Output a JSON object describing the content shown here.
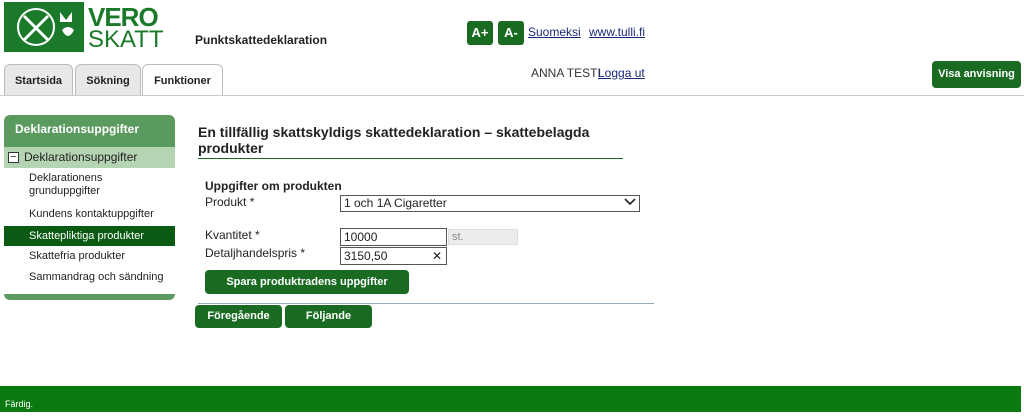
{
  "brand": {
    "line1": "VERO",
    "line2": "SKATT"
  },
  "header": {
    "app_title": "Punktskattedeklaration",
    "font_increase": "A+",
    "font_decrease": "A-",
    "link_language": "Suomeksi",
    "link_customs": "www.tulli.fi"
  },
  "tabs": [
    {
      "label": "Startsida"
    },
    {
      "label": "Sökning"
    },
    {
      "label": "Funktioner"
    }
  ],
  "user": {
    "name": "ANNA TESTI",
    "logout": "Logga ut"
  },
  "help_button": "Visa anvisning",
  "sidebar": {
    "title": "Deklarationsuppgifter",
    "group": "Deklarationsuppgifter",
    "items": [
      {
        "label": "Deklarationens grunduppgifter"
      },
      {
        "label": "Kundens kontaktuppgifter"
      },
      {
        "label": "Skattepliktiga produkter",
        "active": true
      },
      {
        "label": "Skattefria produkter"
      },
      {
        "label": "Sammandrag och sändning"
      }
    ]
  },
  "main": {
    "title": "En tillfällig skattskyldigs skattedeklaration – skattebelagda produkter",
    "section_title": "Uppgifter om produkten",
    "produkt_label": "Produkt *",
    "produkt_value": "1 och 1A Cigaretter",
    "kvantitet_label": "Kvantitet *",
    "kvantitet_value": "10000",
    "unit": "st.",
    "pris_label": "Detaljhandelspris *",
    "pris_value": "3150,50",
    "save_button": "Spara produktradens uppgifter",
    "prev_button": "Föregående",
    "next_button": "Följande"
  },
  "status": {
    "text": "Färdig."
  },
  "colors": {
    "brand_green": "#1a6b22",
    "status_green": "#0a7a10",
    "sidebar_green": "#5a9a5e"
  }
}
